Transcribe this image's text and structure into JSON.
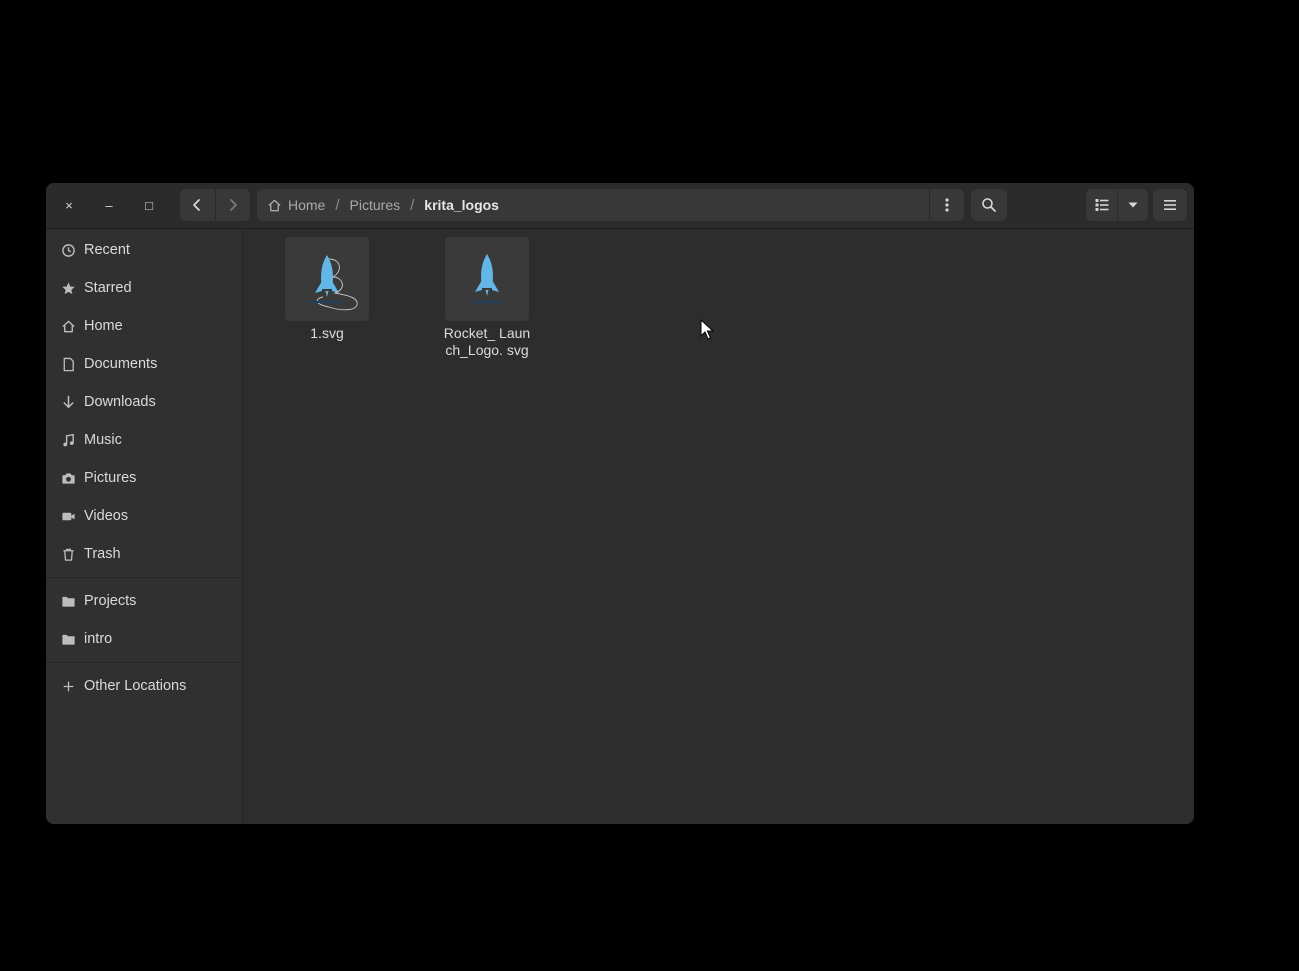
{
  "window": {
    "controls": {
      "close": "×",
      "minimize": "–",
      "maximize": "□"
    }
  },
  "pathbar": {
    "crumbs": [
      {
        "label": "Home",
        "icon": "home-icon"
      },
      {
        "label": "Pictures"
      },
      {
        "label": "krita_logos",
        "current": true
      }
    ],
    "separator": "/"
  },
  "sidebar": {
    "places": [
      {
        "label": "Recent",
        "icon": "clock-icon"
      },
      {
        "label": "Starred",
        "icon": "star-icon"
      },
      {
        "label": "Home",
        "icon": "home-icon"
      },
      {
        "label": "Documents",
        "icon": "document-icon"
      },
      {
        "label": "Downloads",
        "icon": "download-icon"
      },
      {
        "label": "Music",
        "icon": "music-icon"
      },
      {
        "label": "Pictures",
        "icon": "camera-icon"
      },
      {
        "label": "Videos",
        "icon": "video-icon"
      },
      {
        "label": "Trash",
        "icon": "trash-icon"
      }
    ],
    "bookmarks": [
      {
        "label": "Projects",
        "icon": "folder-icon"
      },
      {
        "label": "intro",
        "icon": "folder-icon"
      }
    ],
    "other": {
      "label": "Other Locations",
      "icon": "plus-icon"
    }
  },
  "files": [
    {
      "name": "1.svg",
      "thumbnail": "rocket-logo-sketch"
    },
    {
      "name": "Rocket_ Launch_Logo. svg",
      "thumbnail": "rocket-logo"
    }
  ],
  "colors": {
    "window_bg": "#2d2d2d",
    "sidebar_bg": "#303030",
    "rocket_blue": "#63b6e8"
  }
}
